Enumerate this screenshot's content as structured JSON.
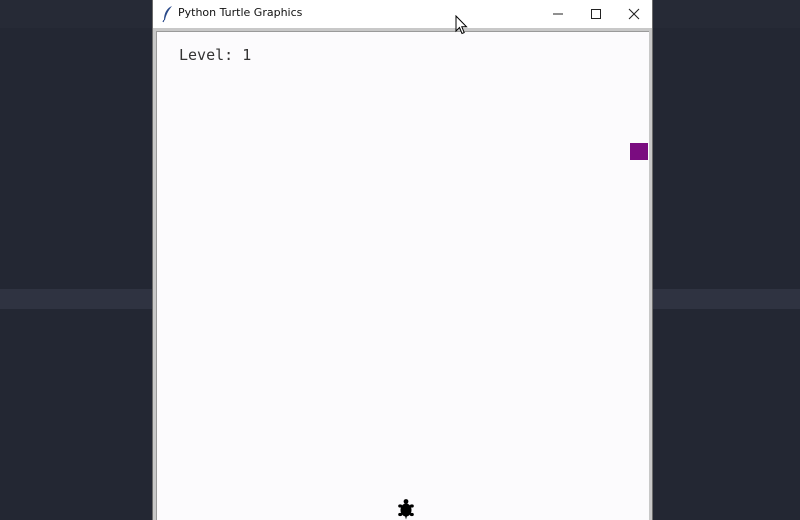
{
  "window": {
    "title": "Python Turtle Graphics",
    "app_icon": "feather-icon",
    "controls": {
      "minimize_icon": "minimize-icon",
      "maximize_icon": "maximize-icon",
      "close_icon": "close-icon"
    }
  },
  "game": {
    "level_text": "Level: 1",
    "car_color": "#7a0c80",
    "player_icon": "turtle-icon",
    "player_color": "#000000"
  },
  "desktop": {
    "background_color": "#232733"
  }
}
